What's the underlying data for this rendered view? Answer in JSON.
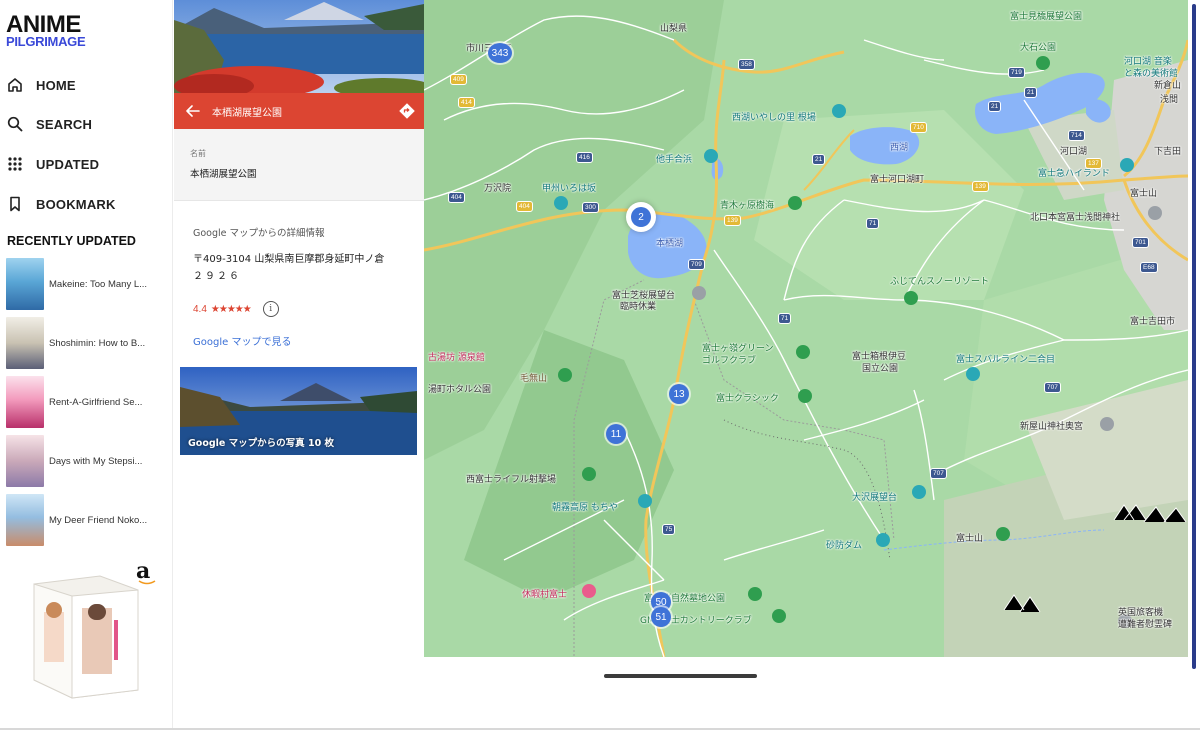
{
  "sidebar": {
    "logo": {
      "line1": "ANIME",
      "line2": "PILGRIMAGE"
    },
    "nav": [
      {
        "label": "HOME",
        "icon": "home-icon"
      },
      {
        "label": "SEARCH",
        "icon": "search-icon"
      },
      {
        "label": "UPDATED",
        "icon": "grid-icon"
      },
      {
        "label": "BOOKMARK",
        "icon": "bookmark-icon"
      }
    ],
    "section_title": "RECENTLY UPDATED",
    "recent": [
      {
        "title": "Makeine: Too Many L..."
      },
      {
        "title": "Shoshimin: How to B..."
      },
      {
        "title": "Rent-A-Girlfriend Se..."
      },
      {
        "title": "Days with My Stepsi..."
      },
      {
        "title": "My Deer Friend Noko..."
      }
    ],
    "ad_logo": "a"
  },
  "panel": {
    "title": "本栖湖展望公園",
    "name_label": "名前",
    "name_value": "本栖湖展望公園",
    "details_heading": "Google マップからの詳細情報",
    "address_line1": "〒409-3104 山梨県南巨摩郡身延町中ノ倉",
    "address_line2": "２９２６",
    "rating": "4.4",
    "stars": "★★★★★",
    "maps_link": "Google マップで見る",
    "photos_caption": "Google マップからの写真 10 枚"
  },
  "map": {
    "labels": [
      {
        "text": "山梨県"
      },
      {
        "text": "市川三郷町"
      },
      {
        "text": "富士見橋展望公園"
      },
      {
        "text": "大石公園"
      },
      {
        "text": "河口湖 音楽"
      },
      {
        "text": "と森の美術館"
      },
      {
        "text": "新倉山"
      },
      {
        "text": "浅間"
      },
      {
        "text": "西湖いやしの里 根場"
      },
      {
        "text": "西湖"
      },
      {
        "text": "下吉田"
      },
      {
        "text": "河口湖"
      },
      {
        "text": "他手合浜"
      },
      {
        "text": "富士河口湖町"
      },
      {
        "text": "富士急ハイランド"
      },
      {
        "text": "富士山"
      },
      {
        "text": "万沢院"
      },
      {
        "text": "甲州いろは坂"
      },
      {
        "text": "青木ヶ原樹海"
      },
      {
        "text": "北口本宮冨士浅間神社"
      },
      {
        "text": "本栖湖"
      },
      {
        "text": "富士芝桜展望台"
      },
      {
        "text": "臨時休業"
      },
      {
        "text": "ふじてんスノーリゾート"
      },
      {
        "text": "富士吉田市"
      },
      {
        "text": "古湯坊 源泉館"
      },
      {
        "text": "毛無山"
      },
      {
        "text": "湯町ホタル公園"
      },
      {
        "text": "富士ヶ嶺グリーン"
      },
      {
        "text": "ゴルフクラブ"
      },
      {
        "text": "富士箱根伊豆"
      },
      {
        "text": "国立公園"
      },
      {
        "text": "富士スバルライン二合目"
      },
      {
        "text": "富士クラシック"
      },
      {
        "text": "新屋山神社奥宮"
      },
      {
        "text": "西富士ライフル射撃場"
      },
      {
        "text": "朝霧高原 もちや"
      },
      {
        "text": "大沢展望台"
      },
      {
        "text": "砂防ダム"
      },
      {
        "text": "富士山"
      },
      {
        "text": "休暇村富士"
      },
      {
        "text": "富士桜自然墓地公園"
      },
      {
        "text": "GMG富士カントリークラブ"
      },
      {
        "text": "英国旅客機"
      },
      {
        "text": "遭難者慰霊碑"
      }
    ],
    "routes": [
      "358",
      "409",
      "414",
      "416",
      "404",
      "404",
      "300",
      "139",
      "710",
      "719",
      "21",
      "21",
      "714",
      "137",
      "139",
      "71",
      "709",
      "71",
      "707",
      "707",
      "701",
      "E68",
      "75",
      "21"
    ],
    "markers": [
      "343",
      "2",
      "13",
      "11",
      "50",
      "51"
    ]
  },
  "colors": {
    "accent": "#dc4532",
    "link": "#3a6fd6",
    "map_land": "#a9d9a6",
    "map_water": "#8ab4f8",
    "marker": "#3f73d7",
    "brand_blue": "#3a49d8"
  }
}
